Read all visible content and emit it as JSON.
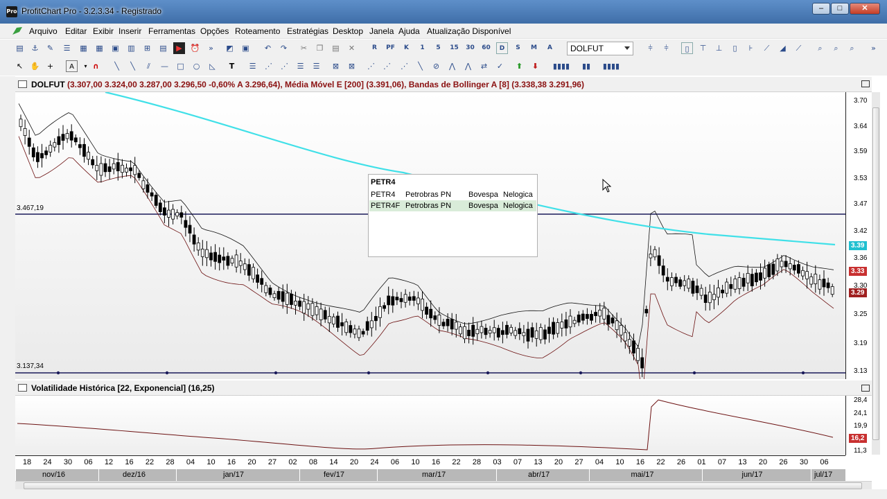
{
  "window": {
    "app_icon_text": "Pro",
    "title": "ProfitChart Pro - 3.2.3.34 - Registrado",
    "minimize": "–",
    "maximize": "□",
    "close": "✕"
  },
  "menu": [
    "Arquivo",
    "Editar",
    "Exibir",
    "Inserir",
    "Ferramentas",
    "Opções",
    "Roteamento",
    "Estratégias",
    "Desktop",
    "Janela",
    "Ajuda",
    "Atualização Disponível"
  ],
  "toolbar": {
    "symbol_value": "DOLFUT",
    "timeframe_buttons": [
      "R",
      "PF",
      "K",
      "1",
      "5",
      "15",
      "30",
      "60",
      "D",
      "S",
      "M",
      "A"
    ]
  },
  "main_chart": {
    "header": "DOLFUT",
    "header_values": "(3.307,00  3.324,00  3.287,00  3.296,50  -0,60%  A 3.296,64), Média Móvel E [200] (3.391,06), Bandas de Bollinger A [8] (3.338,38  3.291,96)",
    "hline_top_label": "3.467,19",
    "hline_bottom_label": "3.137,34",
    "y_ticks": [
      "3.70",
      "3.64",
      "3.59",
      "3.53",
      "3.47",
      "3.42",
      "3.36",
      "3.30",
      "3.25",
      "3.19",
      "3.13"
    ],
    "badges": [
      {
        "text": "3.39",
        "color": "#20c0d0"
      },
      {
        "text": "3.33",
        "color": "#c83030"
      },
      {
        "text": "3.29",
        "color": "#a02020"
      }
    ]
  },
  "indicator_chart": {
    "header": "Volatilidade Histórica [22, Exponencial] (16,25)",
    "y_ticks": [
      "28,4",
      "24,1",
      "19,9",
      "11,3"
    ],
    "badge": {
      "text": "16,2",
      "color": "#c83030"
    }
  },
  "x_axis": {
    "days": [
      "18",
      "24",
      "30",
      "06",
      "12",
      "16",
      "22",
      "28",
      "04",
      "10",
      "16",
      "20",
      "27",
      "02",
      "08",
      "14",
      "20",
      "24",
      "06",
      "10",
      "16",
      "22",
      "28",
      "03",
      "07",
      "13",
      "20",
      "27",
      "04",
      "10",
      "16",
      "22",
      "26",
      "01",
      "07",
      "13",
      "20",
      "26",
      "30",
      "06"
    ],
    "months": [
      "nov/16",
      "dez/16",
      "jan/17",
      "fev/17",
      "mar/17",
      "abr/17",
      "mai/17",
      "jun/17",
      "jul/17"
    ]
  },
  "symbol_popup": {
    "input_value": "PETR4",
    "rows": [
      {
        "ticker": "PETR4",
        "name": "Petrobras PN",
        "exchange": "Bovespa",
        "source": "Nelogica"
      },
      {
        "ticker": "PETR4F",
        "name": "Petrobras PN",
        "exchange": "Bovespa",
        "source": "Nelogica"
      }
    ]
  },
  "chart_data": {
    "type": "candlestick",
    "title": "DOLFUT",
    "series": [
      {
        "name": "Média Móvel E [200]",
        "color": "#40e0e8"
      },
      {
        "name": "Bandas de Bollinger A [8]",
        "color": "#000000"
      }
    ],
    "ylim": [
      3.13,
      3.71
    ],
    "last": {
      "open": 3307.0,
      "high": 3324.0,
      "low": 3287.0,
      "close": 3296.5,
      "change_pct": -0.6
    }
  }
}
